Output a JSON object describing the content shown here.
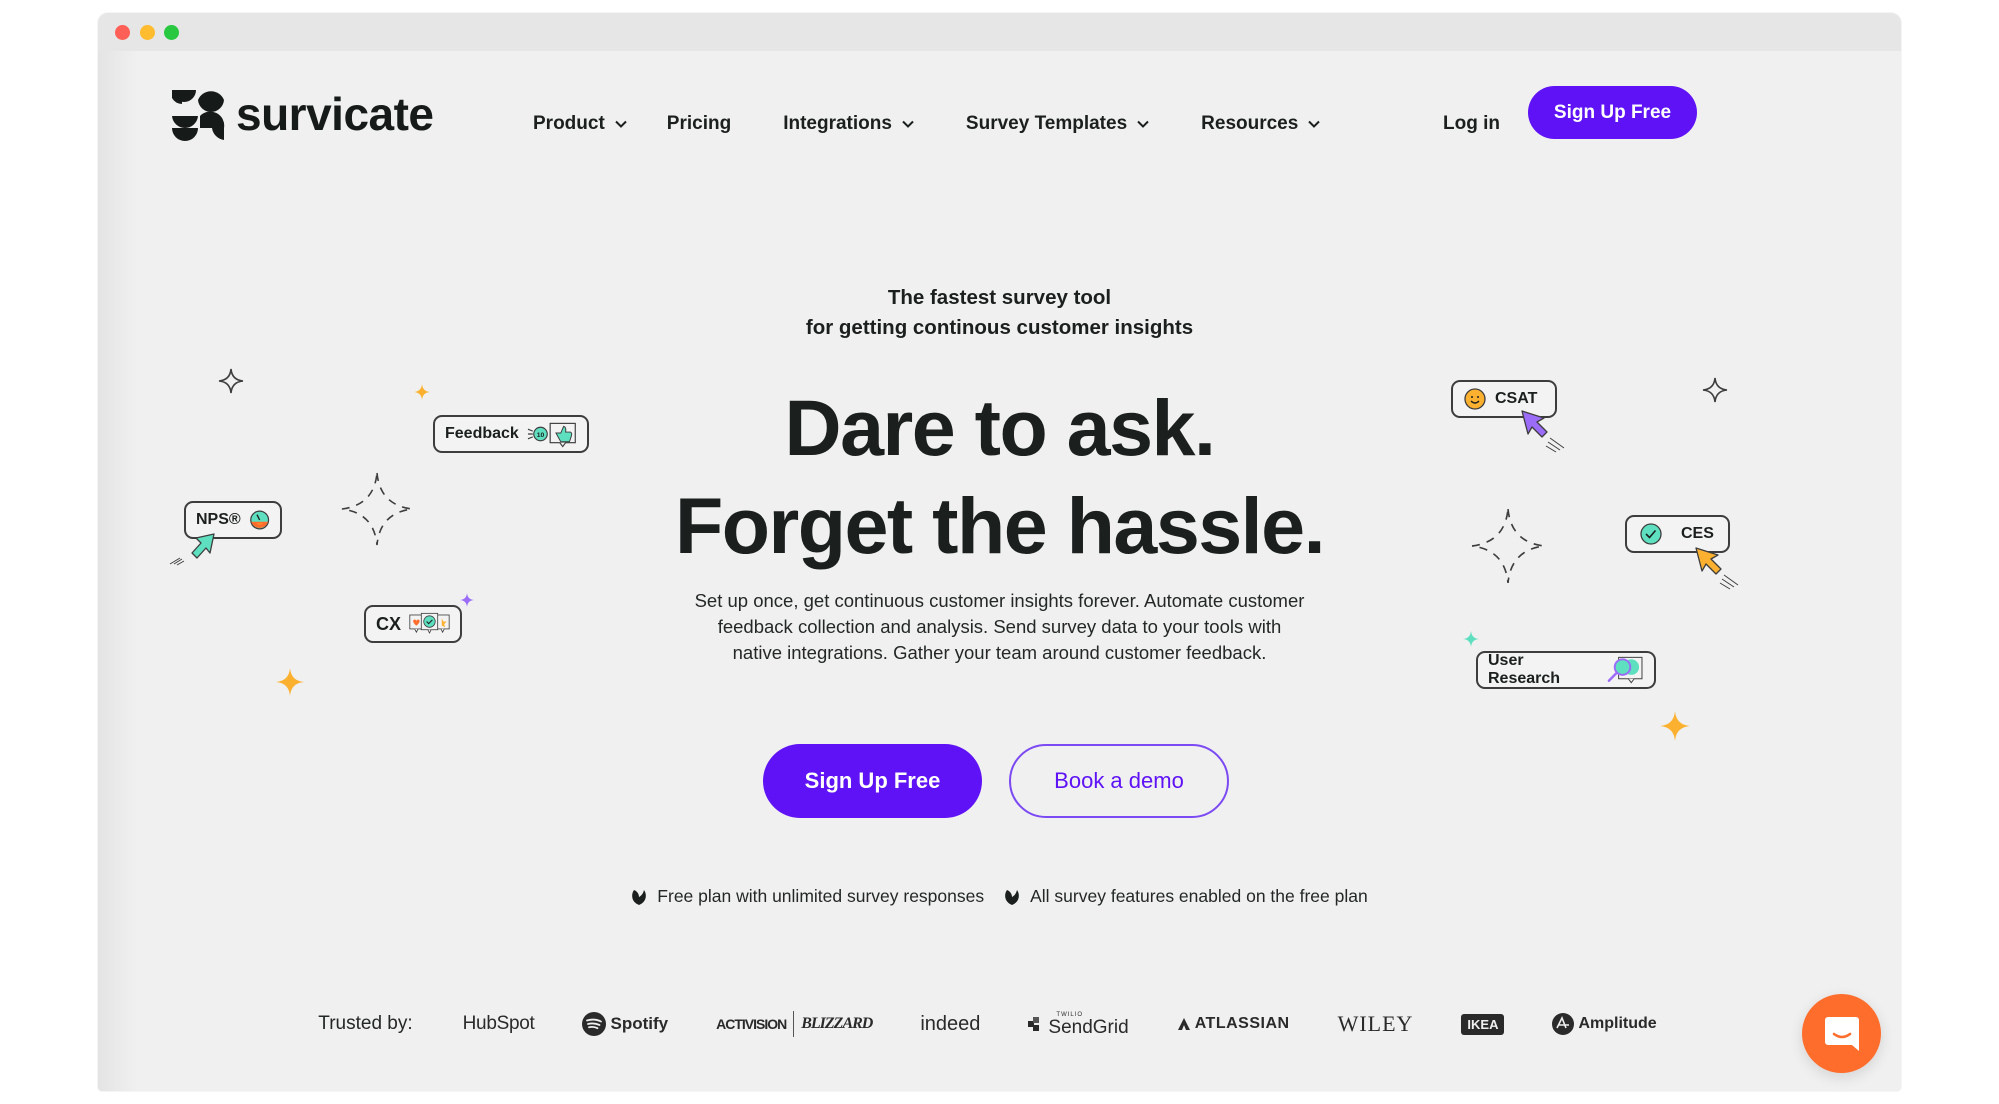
{
  "window": {
    "traffic_lights": [
      "close",
      "minimize",
      "zoom"
    ]
  },
  "header": {
    "logo_text": "survicate",
    "nav": [
      {
        "label": "Product",
        "has_dropdown": true
      },
      {
        "label": "Pricing",
        "has_dropdown": false
      },
      {
        "label": "Integrations",
        "has_dropdown": true
      },
      {
        "label": "Survey Templates",
        "has_dropdown": true
      },
      {
        "label": "Resources",
        "has_dropdown": true
      }
    ],
    "login_label": "Log in",
    "signup_label": "Sign Up Free"
  },
  "hero": {
    "kicker_line1": "The fastest survey tool",
    "kicker_line2": "for getting continous customer insights",
    "headline_line1": "Dare to ask.",
    "headline_line2": "Forget the hassle.",
    "description_lines": [
      "Set up once, get continuous customer insights forever. Automate customer",
      "feedback collection and analysis. Send survey data to your tools with",
      "native integrations. Gather your team around customer feedback."
    ],
    "primary_cta": "Sign Up Free",
    "secondary_cta": "Book a demo",
    "perks": [
      "Free plan with unlimited survey responses",
      "All survey features enabled on the free plan"
    ]
  },
  "badges": {
    "feedback": "Feedback",
    "nps": "NPS®",
    "cx": "CX",
    "csat": "CSAT",
    "ces": "CES",
    "user_research": "User Research",
    "feedback_score": "10"
  },
  "trusted": {
    "label": "Trusted by:",
    "logos": [
      "HubSpot",
      "Spotify",
      "ACTIVISION",
      "BLIZZARD",
      "indeed",
      "TWILIO",
      "SendGrid",
      "ATLASSIAN",
      "WILEY",
      "IKEA",
      "Amplitude"
    ]
  },
  "colors": {
    "brand_purple": "#5e12f5",
    "chat_orange": "#ff6d2c",
    "accent_teal": "#5ee0c0",
    "accent_yellow": "#fbb12f",
    "accent_violet": "#9b6cf7",
    "text_dark": "#1b1f1e",
    "background": "#f0f0f0"
  },
  "chat_widget": {
    "icon": "chat-bubble-smile-icon"
  }
}
